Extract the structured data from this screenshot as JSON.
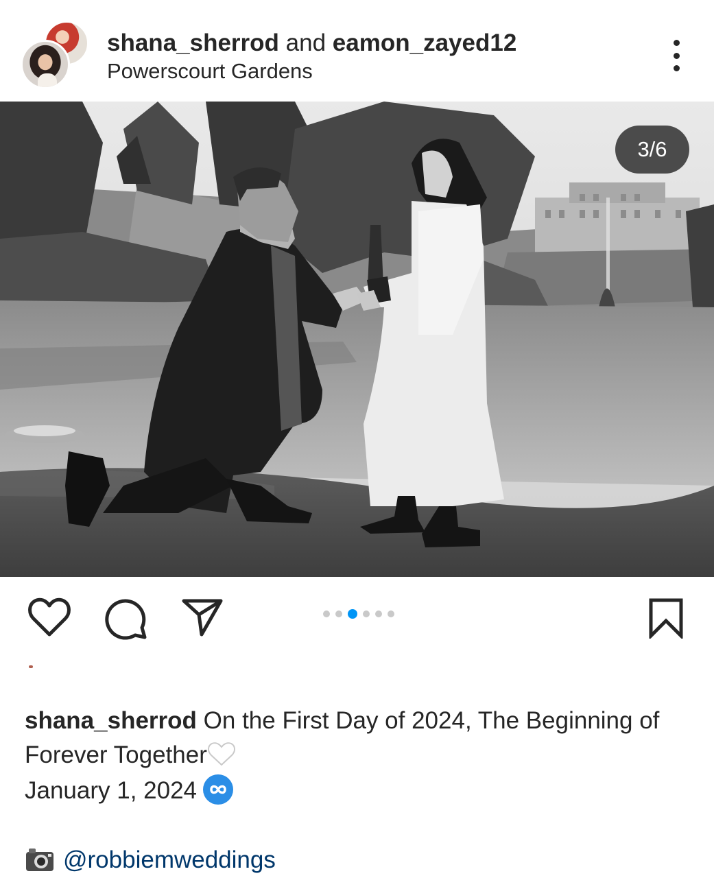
{
  "post": {
    "author_primary": "shana_sherrod",
    "joiner": " and ",
    "author_secondary": "eamon_zayed12",
    "location": "Powerscourt Gardens",
    "more_icon": "more-vertical-icon"
  },
  "media": {
    "counter": "3/6",
    "carousel": {
      "total": 6,
      "active_index": 2
    },
    "description_icon": "photo"
  },
  "actions": {
    "like_icon": "heart-outline-icon",
    "comment_icon": "comment-bubble-icon",
    "share_icon": "paper-plane-icon",
    "save_icon": "bookmark-outline-icon",
    "accent_color": "#0095f6"
  },
  "caption": {
    "username": "shana_sherrod",
    "text": " On the First Day of 2024, The Beginning of Forever Together",
    "emoji": "white-heart",
    "date": "January 1, 2024",
    "date_emoji": "infinity",
    "credit_emoji": "camera-with-flash",
    "credit_handle": "@robbiemweddings",
    "link_color": "#00376b"
  }
}
